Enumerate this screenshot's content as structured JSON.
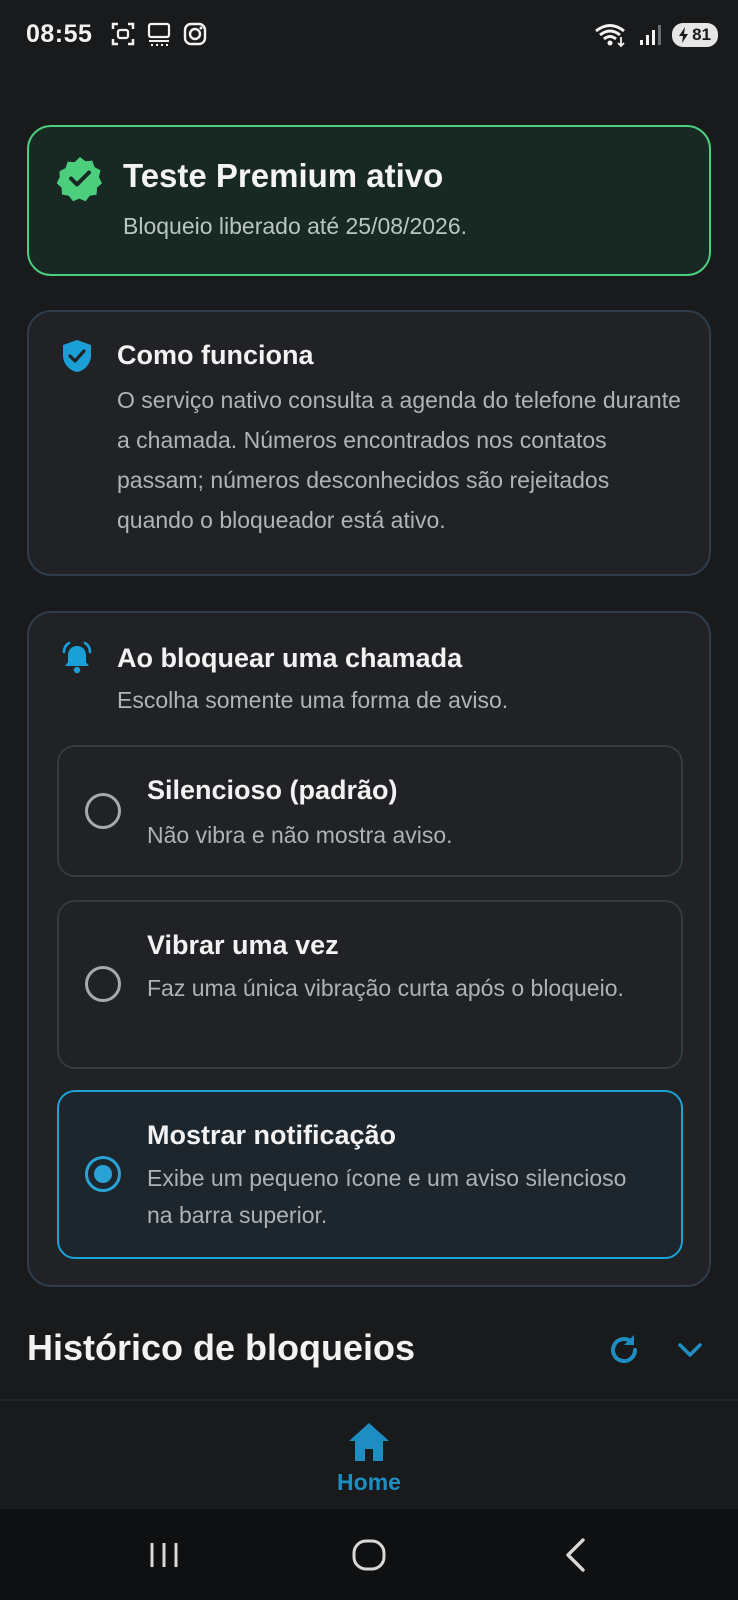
{
  "status_bar": {
    "time": "08:55",
    "battery": "81",
    "icons_left": [
      "screenshot-icon",
      "cast-icon",
      "instagram-icon"
    ],
    "icons_right": [
      "wifi-icon",
      "signal-icon",
      "battery-icon"
    ]
  },
  "premium": {
    "title": "Teste Premium ativo",
    "subtitle": "Bloqueio liberado até 25/08/2026.",
    "icon": "verified-badge-icon",
    "accent": "#4ccf7d"
  },
  "info": {
    "title": "Como funciona",
    "body": "O serviço nativo consulta a agenda do telefone durante a chamada. Números encontrados nos contatos passam; números desconhecidos são rejeitados quando o bloqueador está ativo.",
    "icon": "shield-check-icon"
  },
  "notify": {
    "title": "Ao bloquear uma chamada",
    "subtitle": "Escolha somente uma forma de aviso.",
    "icon": "bell-ringing-icon",
    "options": [
      {
        "title": "Silencioso (padrão)",
        "subtitle": "Não vibra e não mostra aviso.",
        "selected": false
      },
      {
        "title": "Vibrar uma vez",
        "subtitle": "Faz uma única vibração curta após o bloqueio.",
        "selected": false
      },
      {
        "title": "Mostrar notificação",
        "subtitle": "Exibe um pequeno ícone e um aviso silencioso na barra superior.",
        "selected": true
      }
    ]
  },
  "history": {
    "title": "Histórico de bloqueios",
    "icons": [
      "refresh-icon",
      "chevron-down-icon"
    ]
  },
  "bottom_nav": {
    "home_label": "Home",
    "home_icon": "home-icon"
  },
  "colors": {
    "accent_blue": "#1e8ec2",
    "background": "#181a1c"
  }
}
